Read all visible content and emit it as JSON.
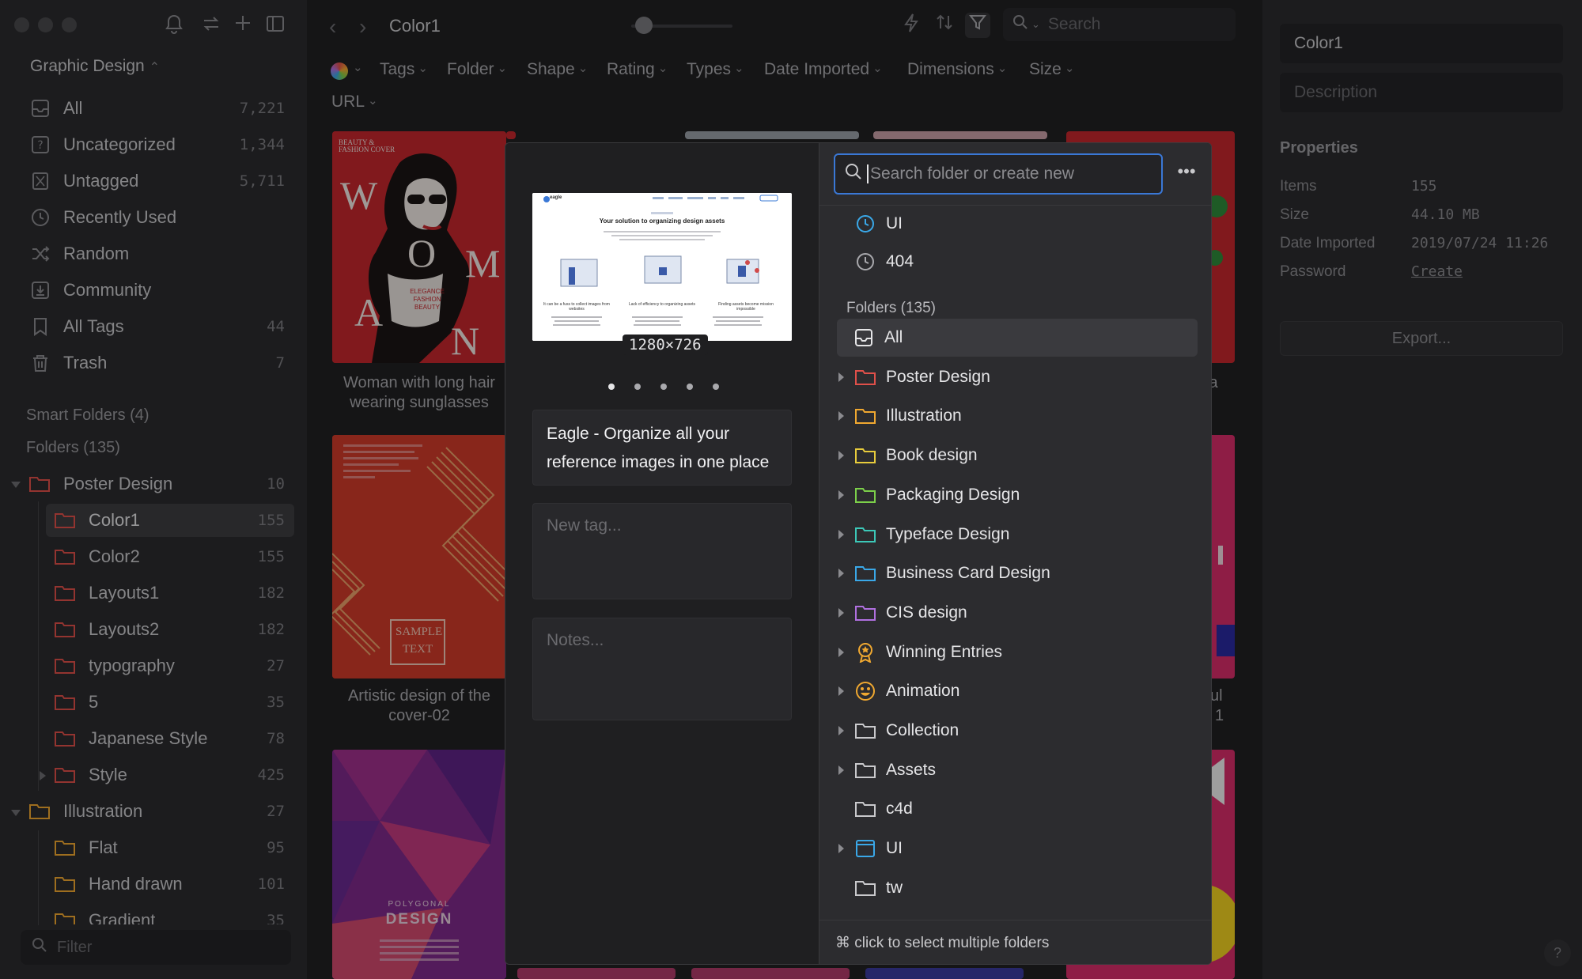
{
  "window": {
    "library_name": "Graphic Design"
  },
  "sidebar": {
    "nav": [
      {
        "label": "All",
        "count": "7,221",
        "icon": "inbox-icon"
      },
      {
        "label": "Uncategorized",
        "count": "1,344",
        "icon": "question-box-icon"
      },
      {
        "label": "Untagged",
        "count": "5,711",
        "icon": "tag-off-icon"
      },
      {
        "label": "Recently Used",
        "count": "",
        "icon": "clock-icon"
      },
      {
        "label": "Random",
        "count": "",
        "icon": "shuffle-icon"
      },
      {
        "label": "Community",
        "count": "",
        "icon": "download-box-icon"
      },
      {
        "label": "All Tags",
        "count": "44",
        "icon": "bookmark-icon"
      },
      {
        "label": "Trash",
        "count": "7",
        "icon": "trash-icon"
      }
    ],
    "smart_folders": "Smart Folders (4)",
    "folders_header": "Folders (135)",
    "tree": [
      {
        "label": "Poster Design",
        "count": "10",
        "color": "#e0504a"
      },
      {
        "label": "Color1",
        "count": "155",
        "color": "#e0504a"
      },
      {
        "label": "Color2",
        "count": "155",
        "color": "#e0504a"
      },
      {
        "label": "Layouts1",
        "count": "182",
        "color": "#e0504a"
      },
      {
        "label": "Layouts2",
        "count": "182",
        "color": "#e0504a"
      },
      {
        "label": "typography",
        "count": "27",
        "color": "#e0504a"
      },
      {
        "label": "5",
        "count": "35",
        "color": "#e0504a"
      },
      {
        "label": "Japanese Style",
        "count": "78",
        "color": "#e0504a"
      },
      {
        "label": "Style",
        "count": "425",
        "color": "#e0504a"
      },
      {
        "label": "Illustration",
        "count": "27",
        "color": "#f0a830"
      },
      {
        "label": "Flat",
        "count": "95",
        "color": "#f0a830"
      },
      {
        "label": "Hand drawn",
        "count": "101",
        "color": "#f0a830"
      },
      {
        "label": "Gradient",
        "count": "35",
        "color": "#f0a830"
      }
    ],
    "filter_placeholder": "Filter"
  },
  "main": {
    "title": "Color1",
    "search_placeholder": "Search",
    "filters": [
      "Tags",
      "Folder",
      "Shape",
      "Rating",
      "Types",
      "Date Imported",
      "Dimensions",
      "Size",
      "URL"
    ],
    "captions": {
      "woman": "Woman with long hair wearing sunglasses",
      "artistic": "Artistic design of the cover-02",
      "right1": "ia",
      "right2": "ul",
      "right3": "1"
    },
    "poster_text": {
      "beauty": "BEAUTY & FASHION COVER",
      "woman_w": "W",
      "woman_o": "O",
      "woman_m": "M",
      "woman_a": "A",
      "woman_n": "N",
      "elegance": "ELEGANCE FASHION BEAUTY",
      "sample": "SAMPLE TEXT",
      "polygonal": "POLYGONAL",
      "design": "DESIGN"
    }
  },
  "inspector": {
    "name_value": "Color1",
    "description_placeholder": "Description",
    "properties_title": "Properties",
    "props": [
      {
        "label": "Items",
        "value": "155"
      },
      {
        "label": "Size",
        "value": "44.10 MB"
      },
      {
        "label": "Date Imported",
        "value": "2019/07/24 11:26"
      },
      {
        "label": "Password",
        "value": "Create"
      }
    ],
    "export_label": "Export...",
    "help_label": "?"
  },
  "modal": {
    "dimensions": "1280×726",
    "thumb_headline": "Your solution to organizing design assets",
    "thumb_logo": "eagle",
    "thumb_cols": [
      "It can be a fuss to collect images from websites",
      "Lack of efficiency to organizing assets",
      "Finding assets become mission impossible"
    ],
    "title_value": "Eagle - Organize all your reference images in one place",
    "tag_placeholder": "New tag...",
    "notes_placeholder": "Notes...",
    "folder_search_placeholder": "Search folder or create new",
    "recent": [
      {
        "label": "UI",
        "icon": "clock-icon"
      },
      {
        "label": "404",
        "icon": "clock-icon"
      }
    ],
    "folders_header": "Folders (135)",
    "folders": [
      {
        "label": "All",
        "icon": "inbox-icon",
        "expandable": false,
        "color": "#e5e5e7"
      },
      {
        "label": "Poster Design",
        "icon": "folder-icon",
        "expandable": true,
        "color": "#e0504a"
      },
      {
        "label": "Illustration",
        "icon": "folder-icon",
        "expandable": true,
        "color": "#f0a830"
      },
      {
        "label": "Book design",
        "icon": "folder-icon",
        "expandable": true,
        "color": "#e8cc3c"
      },
      {
        "label": "Packaging Design",
        "icon": "folder-icon",
        "expandable": true,
        "color": "#7cd04a"
      },
      {
        "label": "Typeface Design",
        "icon": "folder-icon",
        "expandable": true,
        "color": "#3cc8b8"
      },
      {
        "label": "Business Card Design",
        "icon": "folder-icon",
        "expandable": true,
        "color": "#3aa8e8"
      },
      {
        "label": "CIS design",
        "icon": "folder-icon",
        "expandable": true,
        "color": "#b070e0"
      },
      {
        "label": "Winning Entries",
        "icon": "award-icon",
        "expandable": true,
        "color": "#f0a830"
      },
      {
        "label": "Animation",
        "icon": "smiley-icon",
        "expandable": true,
        "color": "#f0a830"
      },
      {
        "label": "Collection",
        "icon": "folder-icon",
        "expandable": true,
        "color": "#c9c9cc"
      },
      {
        "label": "Assets",
        "icon": "folder-icon",
        "expandable": true,
        "color": "#c9c9cc"
      },
      {
        "label": "c4d",
        "icon": "folder-icon",
        "expandable": false,
        "color": "#c9c9cc"
      },
      {
        "label": "UI",
        "icon": "window-icon",
        "expandable": true,
        "color": "#3aa8e8"
      },
      {
        "label": "tw",
        "icon": "folder-icon",
        "expandable": false,
        "color": "#c9c9cc"
      }
    ],
    "footer": "⌘ click to select multiple folders"
  }
}
